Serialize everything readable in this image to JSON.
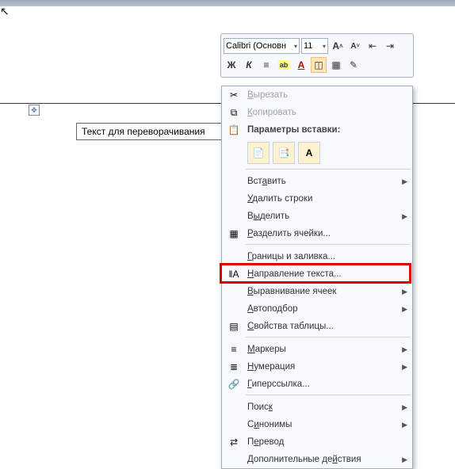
{
  "toolbar": {
    "font": "Calibri (Основн",
    "size": "11",
    "bold": "Ж",
    "italic": "К",
    "align": "≡",
    "highlight": "ab",
    "font_color": "A"
  },
  "document": {
    "cell_text": "Текст для переворачивания"
  },
  "context_menu": {
    "cut": "Вырезать",
    "copy": "Копировать",
    "paste_options_header": "Параметры вставки:",
    "insert": "Вставить",
    "delete_rows": "Удалить строки",
    "select": "Выделить",
    "split_cells": "Разделить ячейки...",
    "borders_shading": "Границы и заливка...",
    "text_direction": "Направление текста...",
    "cell_alignment": "Выравнивание ячеек",
    "autofit": "Автоподбор",
    "table_properties": "Свойства таблицы...",
    "bullets": "Маркеры",
    "numbering": "Нумерация",
    "hyperlink": "Гиперссылка...",
    "search": "Поиск",
    "synonyms": "Синонимы",
    "translate": "Перевод",
    "additional_actions": "Дополнительные действия"
  },
  "highlight_target": "text_direction"
}
